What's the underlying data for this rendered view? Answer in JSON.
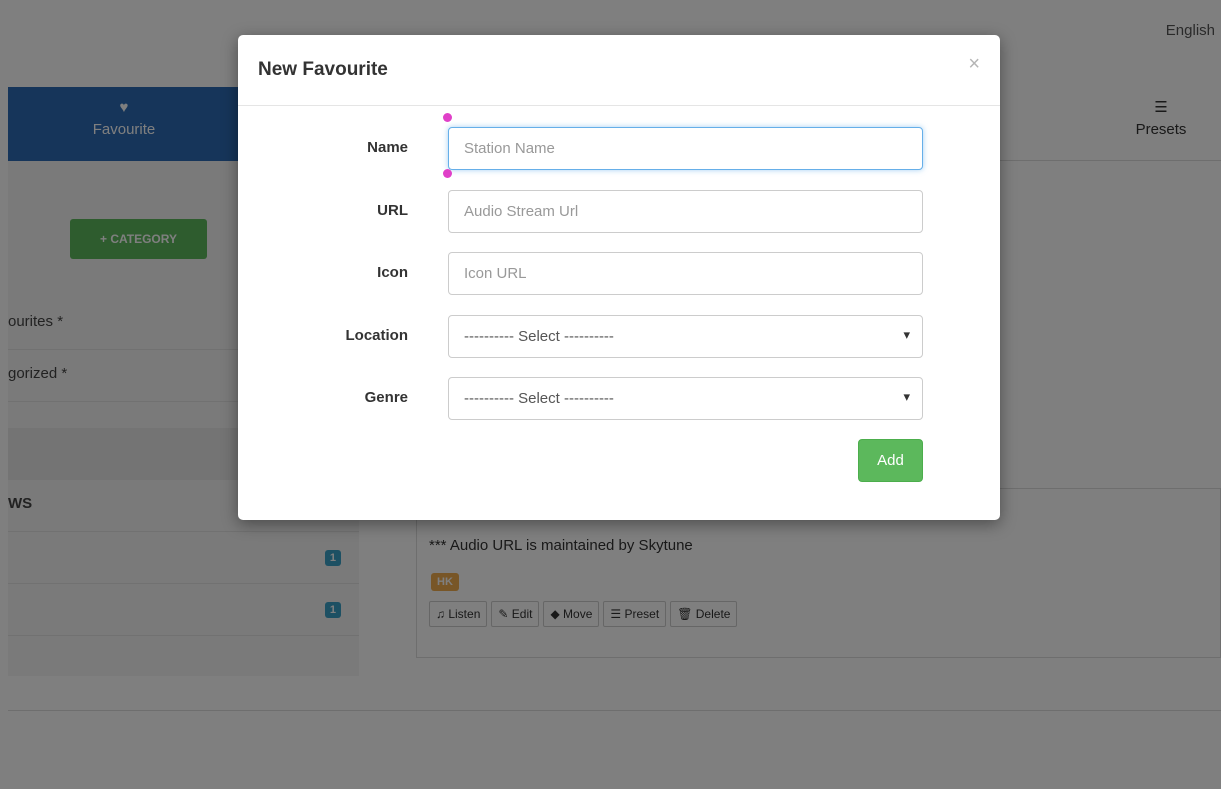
{
  "page": {
    "language": "English",
    "tabs": [
      {
        "label": "Favourite",
        "icon": "heart-icon"
      },
      {
        "label": "Presets",
        "icon": "list-icon"
      }
    ],
    "sidebar": {
      "category_button": "+ CATEGORY",
      "items": [
        "ourites *",
        "gorized *"
      ],
      "group_label": "WS",
      "badges": [
        "1",
        "1"
      ]
    },
    "station": {
      "note": "*** Audio URL is maintained by Skytune",
      "tag": "HK",
      "actions": [
        "Listen",
        "Edit",
        "Move",
        "Preset",
        "Delete"
      ]
    }
  },
  "modal": {
    "title": "New Favourite",
    "close": "×",
    "fields": {
      "name": {
        "label": "Name",
        "placeholder": "Station Name"
      },
      "url": {
        "label": "URL",
        "placeholder": "Audio Stream Url"
      },
      "icon": {
        "label": "Icon",
        "placeholder": "Icon URL"
      },
      "location": {
        "label": "Location",
        "value": "---------- Select ----------"
      },
      "genre": {
        "label": "Genre",
        "value": "---------- Select ----------"
      }
    },
    "submit": "Add"
  },
  "colors": {
    "primary": "#2c6bb5",
    "success": "#5cb85c",
    "info_badge": "#3aa0c7",
    "warning_tag": "#f0ad4e",
    "focus_border": "#66afe9"
  }
}
